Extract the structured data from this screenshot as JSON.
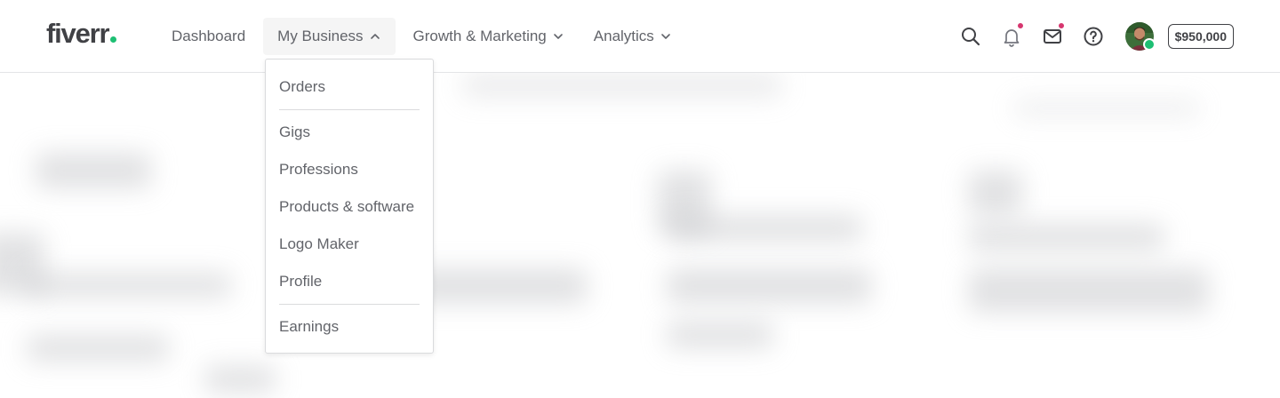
{
  "brand": {
    "logo_text": "fiverr",
    "accent_color": "#1dbf73"
  },
  "nav": {
    "items": [
      {
        "label": "Dashboard",
        "has_chevron": false
      },
      {
        "label": "My Business",
        "has_chevron": true,
        "expanded": true
      },
      {
        "label": "Growth & Marketing",
        "has_chevron": true
      },
      {
        "label": "Analytics",
        "has_chevron": true
      }
    ]
  },
  "dropdown": {
    "groups": [
      [
        "Orders"
      ],
      [
        "Gigs",
        "Professions",
        "Products & software",
        "Logo Maker",
        "Profile"
      ],
      [
        "Earnings"
      ]
    ]
  },
  "toolbar": {
    "icons": [
      "search-icon",
      "bell-icon",
      "mail-icon",
      "help-icon"
    ],
    "notification_dot_color": "#d6366f",
    "balance": "$950,000",
    "online_status_color": "#1dbf73"
  }
}
